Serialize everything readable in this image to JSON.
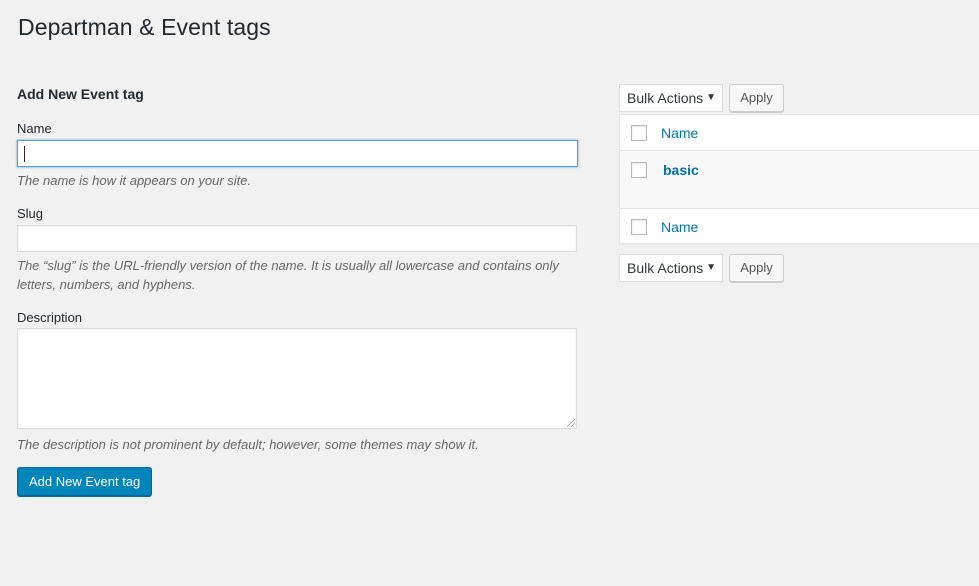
{
  "page": {
    "title": "Departman & Event tags"
  },
  "form": {
    "heading": "Add New Event tag",
    "name": {
      "label": "Name",
      "value": "",
      "hint": "The name is how it appears on your site."
    },
    "slug": {
      "label": "Slug",
      "value": "",
      "hint": "The “slug” is the URL-friendly version of the name. It is usually all lowercase and contains only letters, numbers, and hyphens."
    },
    "description": {
      "label": "Description",
      "value": "",
      "hint": "The description is not prominent by default; however, some themes may show it."
    },
    "submit_label": "Add New Event tag"
  },
  "tablenav_top": {
    "bulk_actions": "Bulk Actions",
    "apply": "Apply"
  },
  "tablenav_bottom": {
    "bulk_actions": "Bulk Actions",
    "apply": "Apply"
  },
  "table": {
    "header_column": "Name",
    "footer_column": "Name",
    "rows": [
      {
        "name": "basic"
      }
    ]
  },
  "colors": {
    "primary": "#0085ba",
    "link": "#0073aa",
    "background": "#f1f1f1"
  }
}
